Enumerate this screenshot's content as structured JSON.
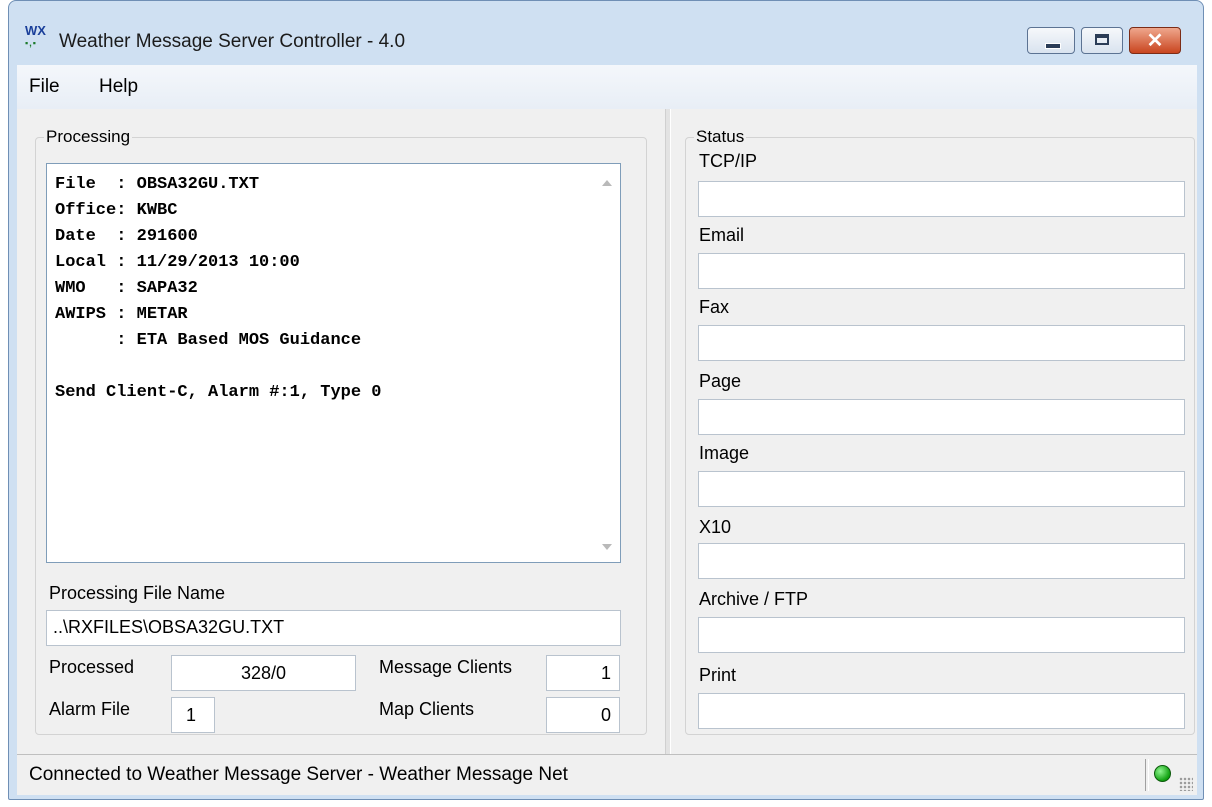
{
  "window": {
    "title": "Weather Message Server Controller - 4.0",
    "icon_line1": "WX",
    "icon_line2": "▪,▪"
  },
  "menu": {
    "file": "File",
    "help": "Help"
  },
  "processing": {
    "group_label": "Processing",
    "log_text": "File  : OBSA32GU.TXT\nOffice: KWBC\nDate  : 291600\nLocal : 11/29/2013 10:00\nWMO   : SAPA32\nAWIPS : METAR\n      : ETA Based MOS Guidance\n\nSend Client-C, Alarm #:1, Type 0",
    "file_name_label": "Processing File Name",
    "file_name_value": "..\\RXFILES\\OBSA32GU.TXT",
    "processed_label": "Processed",
    "processed_value": "328/0",
    "alarm_file_label": "Alarm File",
    "alarm_file_value": "1",
    "message_clients_label": "Message Clients",
    "message_clients_value": "1",
    "map_clients_label": "Map Clients",
    "map_clients_value": "0"
  },
  "status": {
    "group_label": "Status",
    "items": [
      {
        "label": "TCP/IP",
        "value": ""
      },
      {
        "label": "Email",
        "value": ""
      },
      {
        "label": "Fax",
        "value": ""
      },
      {
        "label": "Page",
        "value": ""
      },
      {
        "label": "Image",
        "value": ""
      },
      {
        "label": "X10",
        "value": ""
      },
      {
        "label": "Archive / FTP",
        "value": ""
      },
      {
        "label": "Print",
        "value": ""
      }
    ]
  },
  "statusbar": {
    "text": "Connected to Weather Message Server - Weather Message Net",
    "indicator_color": "#10a010"
  }
}
